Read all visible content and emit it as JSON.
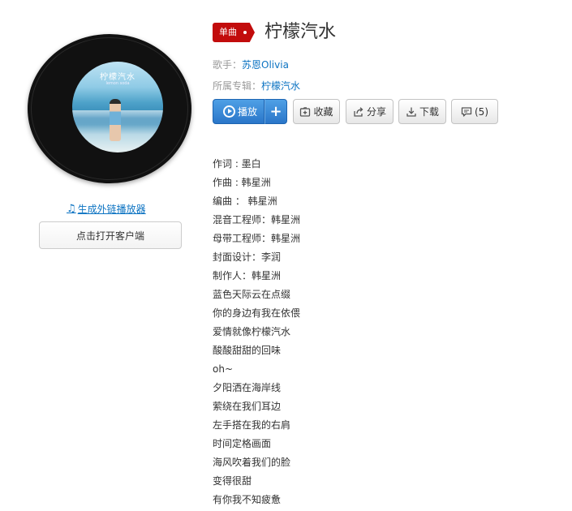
{
  "song": {
    "type_label": "单曲",
    "title": "柠檬汽水"
  },
  "cover": {
    "art_title": "柠檬汽水",
    "art_subtitle": "lemon soda"
  },
  "meta": {
    "singer_label": "歌手：",
    "singer": "苏恩Olivia",
    "album_label": "所属专辑：",
    "album": "柠檬汽水"
  },
  "actions": {
    "play": "播放",
    "add": "+",
    "favorite": "收藏",
    "share": "分享",
    "download": "下载",
    "comments": "(5)"
  },
  "left": {
    "external_player_link": "生成外链播放器",
    "open_client_button": "点击打开客户端"
  },
  "lyrics": [
    "作词 : 墨白",
    "作曲 : 韩星洲",
    "编曲 ： 韩星洲",
    "混音工程师：韩星洲",
    "母带工程师：韩星洲",
    "封面设计：李润",
    "制作人：韩星洲",
    "蓝色天际云在点缀",
    "你的身边有我在依偎",
    "爱情就像柠檬汽水",
    "酸酸甜甜的回味",
    "oh~",
    "夕阳洒在海岸线",
    "萦绕在我们耳边",
    "左手搭在我的右肩",
    "时间定格画面",
    "海风吹着我们的脸",
    "变得很甜",
    "有你我不知疲惫"
  ],
  "colors": {
    "brand_red": "#c20c0c",
    "link_blue": "#0c73c2",
    "play_blue": "#2a76c9"
  },
  "icons": {
    "play": "play-circle-icon",
    "favorite": "folder-add-icon",
    "share": "share-icon",
    "download": "download-icon",
    "comment": "comment-icon",
    "music_note": "music-note-icon"
  }
}
